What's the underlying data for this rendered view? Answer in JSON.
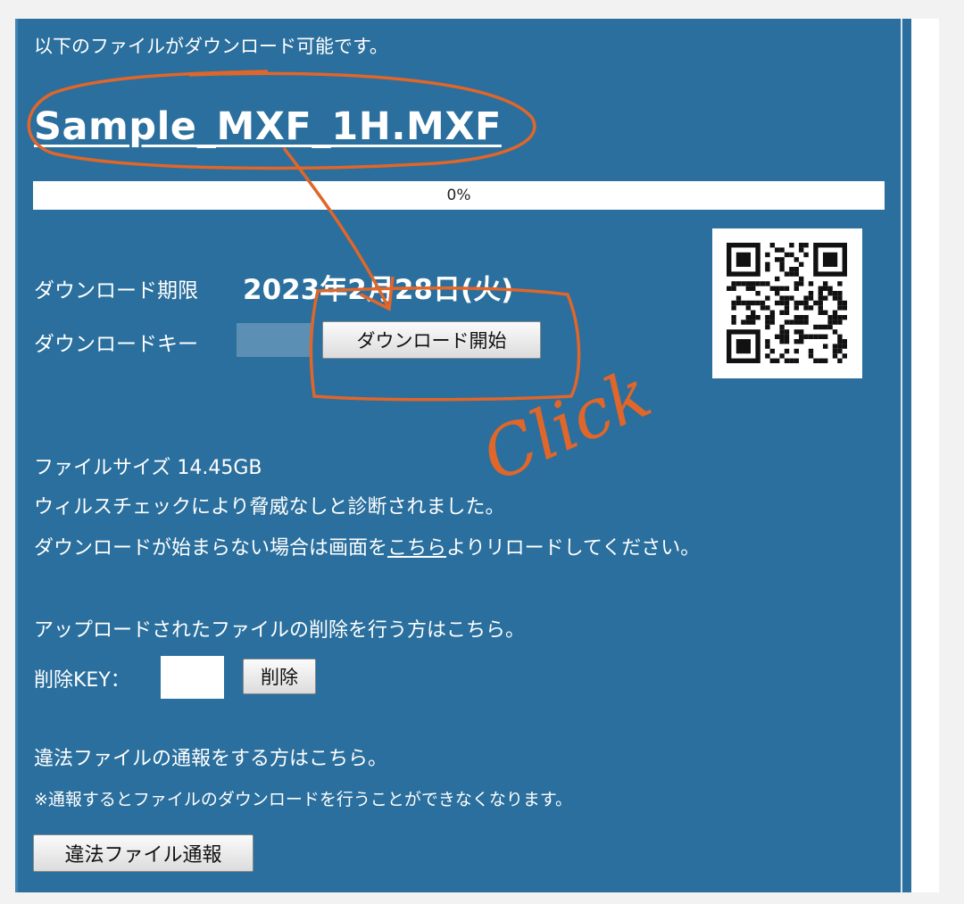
{
  "intro_text": "以下のファイルがダウンロード可能です。",
  "file_name": "Sample_MXF_1H.MXF",
  "progress": {
    "label": "0%",
    "value": 0
  },
  "deadline": {
    "label": "ダウンロード期限",
    "value": "2023年2月28日(火)"
  },
  "download_key": {
    "label": "ダウンロードキー",
    "value": ""
  },
  "download_button_label": "ダウンロード開始",
  "file_size_text": "ファイルサイズ 14.45GB",
  "virus_check_text": "ウィルスチェックにより脅威なしと診断されました。",
  "reload": {
    "before": "ダウンロードが始まらない場合は画面を",
    "link": "こちら",
    "after": "よりリロードしてください。"
  },
  "uploader_delete_text": "アップロードされたファイルの削除を行う方はこちら。",
  "delete_key": {
    "label": "削除KEY：",
    "value": "",
    "button_label": "削除"
  },
  "report": {
    "text": "違法ファイルの通報をする方はこちら。",
    "note": "※通報するとファイルのダウンロードを行うことができなくなります。",
    "button_label": "違法ファイル通報"
  },
  "annotation": {
    "label": "Click",
    "color": "#e0662a"
  },
  "colors": {
    "panel": "#2a6f9d",
    "text": "#ffffff",
    "annotation": "#e0662a"
  }
}
